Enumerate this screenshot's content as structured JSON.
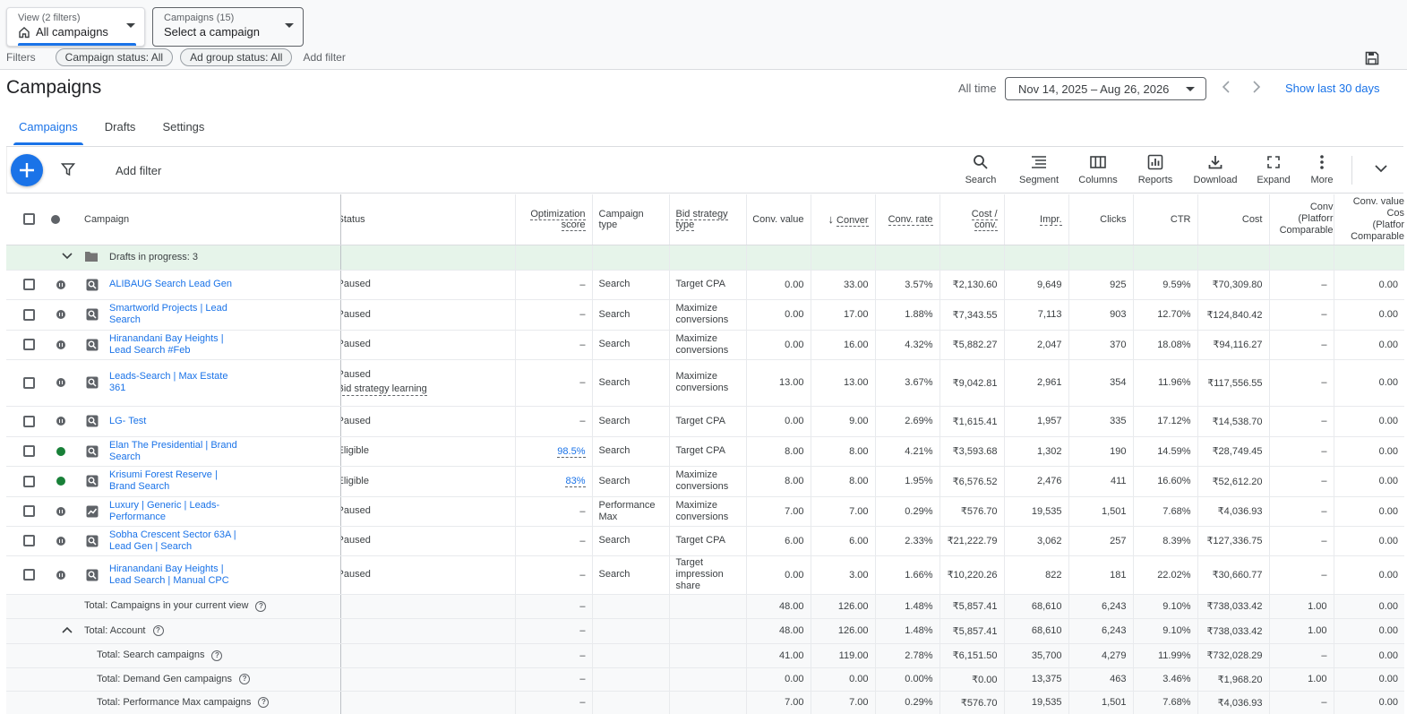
{
  "view_picker": {
    "label": "View (2 filters)",
    "value": "All campaigns"
  },
  "campaign_picker": {
    "label": "Campaigns (15)",
    "value": "Select a campaign"
  },
  "filters": {
    "label": "Filters",
    "chips": [
      "Campaign status: All",
      "Ad group status: All"
    ],
    "add": "Add filter"
  },
  "page": {
    "title": "Campaigns",
    "all_time": "All time",
    "date_range": "Nov 14, 2025 – Aug 26, 2026",
    "show_last": "Show last 30 days"
  },
  "tabs": [
    "Campaigns",
    "Drafts",
    "Settings"
  ],
  "toolbar": {
    "add_filter": "Add filter",
    "tools": [
      "Search",
      "Segment",
      "Columns",
      "Reports",
      "Download",
      "Expand",
      "More"
    ]
  },
  "columns": {
    "campaign": "Campaign",
    "status": "Status",
    "opt_score_1": "Optimization",
    "opt_score_2": "score",
    "campaign_type_1": "Campaign",
    "campaign_type_2": "type",
    "bid_strategy_1": "Bid strategy",
    "bid_strategy_2": "type",
    "conv_value": "Conv. value",
    "conversions": "Conver",
    "conv_rate": "Conv. rate",
    "cost_conv_1": "Cost /",
    "cost_conv_2": "conv.",
    "impr": "Impr.",
    "clicks": "Clicks",
    "ctr": "CTR",
    "cost": "Cost",
    "conv_platform_1": "Conv",
    "conv_platform_2": "(Platforr",
    "conv_platform_3": "Comparable",
    "conv_value_platform_1": "Conv. value",
    "conv_value_platform_2": "Cos",
    "conv_value_platform_3": "(Platfor",
    "conv_value_platform_4": "Comparable"
  },
  "drafts": {
    "label": "Drafts in progress: 3"
  },
  "rows": [
    {
      "state": "paused",
      "icon": "search",
      "name": "ALIBAUG Search Lead Gen",
      "status": "Paused",
      "status2": "",
      "opt": "–",
      "type": "Search",
      "bid": "Target CPA",
      "conv_value": "0.00",
      "conv": "33.00",
      "conv_rate": "3.57%",
      "cost_conv": "₹2,130.60",
      "impr": "9,649",
      "clicks": "925",
      "ctr": "9.59%",
      "cost": "₹70,309.80",
      "conv_platform": "–",
      "value_platform": "0.00"
    },
    {
      "state": "paused",
      "icon": "search",
      "name": "Smartworld Projects | Lead Search",
      "status": "Paused",
      "status2": "",
      "opt": "–",
      "type": "Search",
      "bid": "Maximize conversions",
      "conv_value": "0.00",
      "conv": "17.00",
      "conv_rate": "1.88%",
      "cost_conv": "₹7,343.55",
      "impr": "7,113",
      "clicks": "903",
      "ctr": "12.70%",
      "cost": "₹124,840.42",
      "conv_platform": "–",
      "value_platform": "0.00"
    },
    {
      "state": "paused",
      "icon": "search",
      "name": "Hiranandani Bay Heights | Lead Search #Feb",
      "status": "Paused",
      "status2": "",
      "opt": "–",
      "type": "Search",
      "bid": "Maximize conversions",
      "conv_value": "0.00",
      "conv": "16.00",
      "conv_rate": "4.32%",
      "cost_conv": "₹5,882.27",
      "impr": "2,047",
      "clicks": "370",
      "ctr": "18.08%",
      "cost": "₹94,116.27",
      "conv_platform": "–",
      "value_platform": "0.00"
    },
    {
      "state": "paused",
      "icon": "search",
      "name": "Leads-Search | Max Estate 361",
      "status": "Paused",
      "status2": "Bid strategy learning",
      "opt": "–",
      "type": "Search",
      "bid": "Maximize conversions",
      "conv_value": "13.00",
      "conv": "13.00",
      "conv_rate": "3.67%",
      "cost_conv": "₹9,042.81",
      "impr": "2,961",
      "clicks": "354",
      "ctr": "11.96%",
      "cost": "₹117,556.55",
      "conv_platform": "–",
      "value_platform": "0.00"
    },
    {
      "state": "paused",
      "icon": "search",
      "name": "LG- Test",
      "status": "Paused",
      "status2": "",
      "opt": "–",
      "type": "Search",
      "bid": "Target CPA",
      "conv_value": "0.00",
      "conv": "9.00",
      "conv_rate": "2.69%",
      "cost_conv": "₹1,615.41",
      "impr": "1,957",
      "clicks": "335",
      "ctr": "17.12%",
      "cost": "₹14,538.70",
      "conv_platform": "–",
      "value_platform": "0.00"
    },
    {
      "state": "eligible",
      "icon": "search",
      "name": "Elan The Presidential | Brand Search",
      "status": "Eligible",
      "status2": "",
      "opt": "98.5%",
      "type": "Search",
      "bid": "Target CPA",
      "conv_value": "8.00",
      "conv": "8.00",
      "conv_rate": "4.21%",
      "cost_conv": "₹3,593.68",
      "impr": "1,302",
      "clicks": "190",
      "ctr": "14.59%",
      "cost": "₹28,749.45",
      "conv_platform": "–",
      "value_platform": "0.00"
    },
    {
      "state": "eligible",
      "icon": "search",
      "name": "Krisumi Forest Reserve | Brand Search",
      "status": "Eligible",
      "status2": "",
      "opt": "83%",
      "type": "Search",
      "bid": "Maximize conversions",
      "conv_value": "8.00",
      "conv": "8.00",
      "conv_rate": "1.95%",
      "cost_conv": "₹6,576.52",
      "impr": "2,476",
      "clicks": "411",
      "ctr": "16.60%",
      "cost": "₹52,612.20",
      "conv_platform": "–",
      "value_platform": "0.00"
    },
    {
      "state": "paused",
      "icon": "performance",
      "name": "Luxury | Generic | Leads-Performance",
      "status": "Paused",
      "status2": "",
      "opt": "–",
      "type": "Performance Max",
      "bid": "Maximize conversions",
      "conv_value": "7.00",
      "conv": "7.00",
      "conv_rate": "0.29%",
      "cost_conv": "₹576.70",
      "impr": "19,535",
      "clicks": "1,501",
      "ctr": "7.68%",
      "cost": "₹4,036.93",
      "conv_platform": "–",
      "value_platform": "0.00"
    },
    {
      "state": "paused",
      "icon": "search",
      "name": "Sobha Crescent Sector 63A | Lead Gen | Search",
      "status": "Paused",
      "status2": "",
      "opt": "–",
      "type": "Search",
      "bid": "Target CPA",
      "conv_value": "6.00",
      "conv": "6.00",
      "conv_rate": "2.33%",
      "cost_conv": "₹21,222.79",
      "impr": "3,062",
      "clicks": "257",
      "ctr": "8.39%",
      "cost": "₹127,336.75",
      "conv_platform": "–",
      "value_platform": "0.00"
    },
    {
      "state": "paused",
      "icon": "search",
      "name": "Hiranandani Bay Heights | Lead Search | Manual CPC",
      "status": "Paused",
      "status2": "",
      "opt": "–",
      "type": "Search",
      "bid": "Target impression share",
      "conv_value": "0.00",
      "conv": "3.00",
      "conv_rate": "1.66%",
      "cost_conv": "₹10,220.26",
      "impr": "822",
      "clicks": "181",
      "ctr": "22.02%",
      "cost": "₹30,660.77",
      "conv_platform": "–",
      "value_platform": "0.00"
    }
  ],
  "totals": [
    {
      "label": "Total: Campaigns in your current view",
      "opt": "–",
      "conv_value": "48.00",
      "conv": "126.00",
      "conv_rate": "1.48%",
      "cost_conv": "₹5,857.41",
      "impr": "68,610",
      "clicks": "6,243",
      "ctr": "9.10%",
      "cost": "₹738,033.42",
      "conv_platform": "1.00",
      "value_platform": "0.00"
    },
    {
      "label": "Total: Account",
      "opt": "–",
      "conv_value": "48.00",
      "conv": "126.00",
      "conv_rate": "1.48%",
      "cost_conv": "₹5,857.41",
      "impr": "68,610",
      "clicks": "6,243",
      "ctr": "9.10%",
      "cost": "₹738,033.42",
      "conv_platform": "1.00",
      "value_platform": "0.00"
    },
    {
      "label": "Total: Search campaigns",
      "opt": "–",
      "conv_value": "41.00",
      "conv": "119.00",
      "conv_rate": "2.78%",
      "cost_conv": "₹6,151.50",
      "impr": "35,700",
      "clicks": "4,279",
      "ctr": "11.99%",
      "cost": "₹732,028.29",
      "conv_platform": "–",
      "value_platform": "0.00"
    },
    {
      "label": "Total: Demand Gen campaigns",
      "opt": "–",
      "conv_value": "0.00",
      "conv": "0.00",
      "conv_rate": "0.00%",
      "cost_conv": "₹0.00",
      "impr": "13,375",
      "clicks": "463",
      "ctr": "3.46%",
      "cost": "₹1,968.20",
      "conv_platform": "1.00",
      "value_platform": "0.00"
    },
    {
      "label": "Total: Performance Max campaigns",
      "opt": "–",
      "conv_value": "7.00",
      "conv": "7.00",
      "conv_rate": "0.29%",
      "cost_conv": "₹576.70",
      "impr": "19,535",
      "clicks": "1,501",
      "ctr": "7.68%",
      "cost": "₹4,036.93",
      "conv_platform": "–",
      "value_platform": "0.00"
    }
  ],
  "colors": {
    "accent": "#1a73e8",
    "eligible": "#188038",
    "paused": "#5f6368",
    "drafts_bg": "#e6f4ea"
  }
}
